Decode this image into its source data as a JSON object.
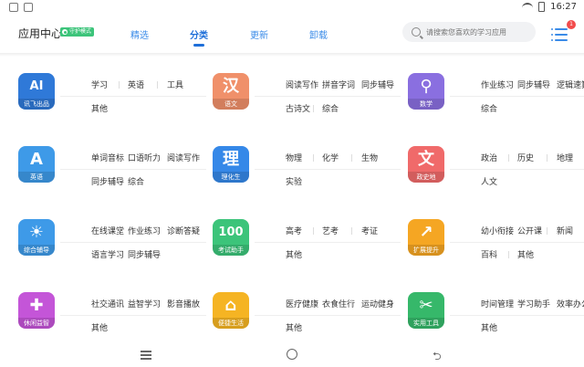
{
  "status": {
    "time": "16:27"
  },
  "header": {
    "title": "应用中心",
    "guard_badge": "守护模式",
    "tabs": [
      {
        "label": "精选"
      },
      {
        "label": "分类"
      },
      {
        "label": "更新"
      },
      {
        "label": "卸载"
      }
    ],
    "search_placeholder": "请搜索您喜欢的学习应用",
    "menu_badge": "1"
  },
  "colors": {
    "accent": "#1e6fd9",
    "ai": "#2f79d8",
    "chinese": "#f0906a",
    "math": "#8a6fe0",
    "english": "#3e9ae8",
    "science": "#3588e8",
    "social": "#f06a6a",
    "general": "#3e9ae8",
    "exam": "#3cc47a",
    "expand": "#f5a623",
    "leisure": "#c455d8",
    "life": "#f5b423",
    "tools": "#36b86a"
  },
  "categories": [
    {
      "glyph": "AI",
      "label": "讯飞出品",
      "color": "#2f79d8",
      "row1": [
        "学习",
        "英语",
        "工具"
      ],
      "row2": [
        "其他"
      ]
    },
    {
      "glyph": "汉",
      "label": "语文",
      "color": "#f0906a",
      "row1": [
        "阅读写作",
        "拼音字词",
        "同步辅导"
      ],
      "row2": [
        "古诗文",
        "综合"
      ]
    },
    {
      "glyph": "⚲",
      "label": "数学",
      "color": "#8a6fe0",
      "row1": [
        "作业练习",
        "同步辅导",
        "逻辑速算"
      ],
      "row2": [
        "综合"
      ]
    },
    {
      "glyph": "A",
      "label": "英语",
      "color": "#3e9ae8",
      "row1": [
        "单词音标",
        "口语听力",
        "阅读写作"
      ],
      "row2": [
        "同步辅导",
        "综合"
      ]
    },
    {
      "glyph": "理",
      "label": "理化生",
      "color": "#3588e8",
      "row1": [
        "物理",
        "化学",
        "生物"
      ],
      "row2": [
        "实验"
      ]
    },
    {
      "glyph": "文",
      "label": "政史地",
      "color": "#f06a6a",
      "row1": [
        "政治",
        "历史",
        "地理"
      ],
      "row2": [
        "人文"
      ]
    },
    {
      "glyph": "☀",
      "label": "综合辅导",
      "color": "#3e9ae8",
      "row1": [
        "在线课堂",
        "作业练习",
        "诊断答疑"
      ],
      "row2": [
        "语言学习",
        "同步辅导"
      ]
    },
    {
      "glyph": "100",
      "label": "考试助手",
      "color": "#3cc47a",
      "row1": [
        "高考",
        "艺考",
        "考证"
      ],
      "row2": [
        "其他"
      ]
    },
    {
      "glyph": "↗",
      "label": "扩展提升",
      "color": "#f5a623",
      "row1": [
        "幼小衔接",
        "公开课",
        "新闻"
      ],
      "row2": [
        "百科",
        "其他"
      ]
    },
    {
      "glyph": "✚",
      "label": "休闲益智",
      "color": "#c455d8",
      "row1": [
        "社交通讯",
        "益智学习",
        "影音播放"
      ],
      "row2": [
        "其他"
      ]
    },
    {
      "glyph": "⌂",
      "label": "便捷生活",
      "color": "#f5b423",
      "row1": [
        "医疗健康",
        "衣食住行",
        "运动健身"
      ],
      "row2": [
        "其他"
      ]
    },
    {
      "glyph": "✂",
      "label": "实用工具",
      "color": "#36b86a",
      "row1": [
        "时间管理",
        "学习助手",
        "效率办公"
      ],
      "row2": [
        "其他"
      ]
    }
  ]
}
